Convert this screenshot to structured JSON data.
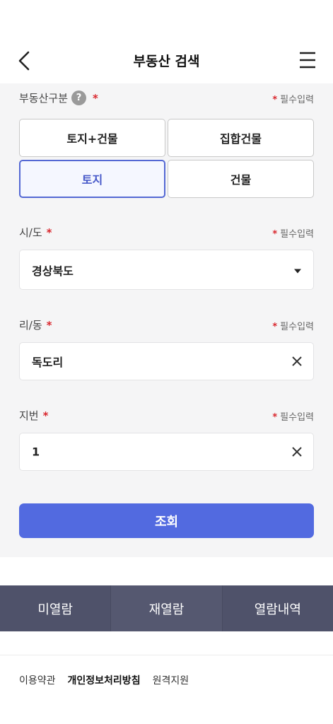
{
  "header": {
    "title": "부동산 검색"
  },
  "property_type": {
    "label": "부동산구분",
    "help": "?",
    "star": "*",
    "required": "필수입력",
    "options": [
      "토지+건물",
      "집합건물",
      "토지",
      "건물"
    ],
    "selected": "토지"
  },
  "sido": {
    "label": "시/도",
    "star": "*",
    "required": "필수입력",
    "value": "경상북도"
  },
  "ridong": {
    "label": "리/동",
    "star": "*",
    "required": "필수입력",
    "value": "독도리"
  },
  "jibun": {
    "label": "지번",
    "star": "*",
    "required": "필수입력",
    "value": "1"
  },
  "submit_label": "조회",
  "bottom_tabs": [
    "미열람",
    "재열람",
    "열람내역"
  ],
  "footer": {
    "terms": "이용약관",
    "privacy": "개인정보처리방침",
    "remote": "원격지원"
  },
  "colors": {
    "accent": "#526ae0",
    "required_star": "#d9272e",
    "tab_bar": "#4f526a"
  },
  "icons": {
    "back": "chevron-left-icon",
    "menu": "hamburger-menu-icon",
    "help": "question-circle-icon",
    "dropdown": "caret-down-icon",
    "clear": "close-icon"
  }
}
